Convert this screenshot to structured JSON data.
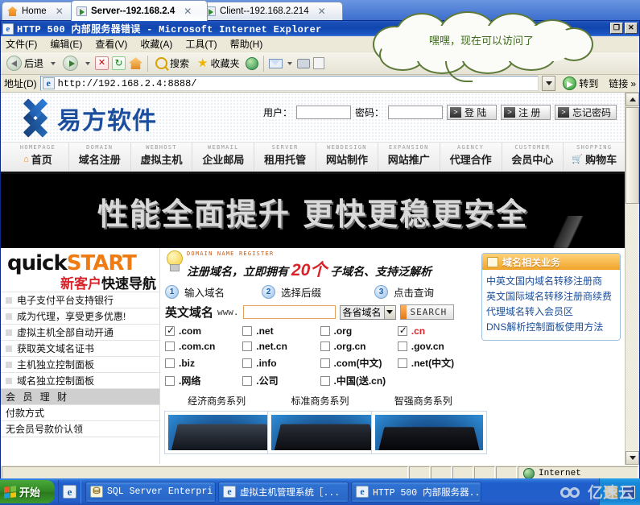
{
  "tabs": [
    {
      "label": "Home",
      "icon": "home-icon",
      "active": false
    },
    {
      "label": "Server--192.168.2.4",
      "icon": "remote-desktop-icon",
      "active": true
    },
    {
      "label": "Client--192.168.2.214",
      "icon": "remote-desktop-icon",
      "active": false
    }
  ],
  "window": {
    "title": "HTTP 500 内部服务器错误 - Microsoft Internet Explorer",
    "restore_label": "❐",
    "close_label": "✕"
  },
  "menubar": [
    "文件(F)",
    "编辑(E)",
    "查看(V)",
    "收藏(A)",
    "工具(T)",
    "帮助(H)"
  ],
  "toolbar": {
    "back": "后退",
    "forward": "",
    "stop": "",
    "refresh": "",
    "home": "",
    "search": "搜索",
    "favorites": "收藏夹",
    "history": "",
    "mail": "",
    "print": "",
    "edit": ""
  },
  "addressbar": {
    "label": "地址(D)",
    "url": "http://192.168.2.4:8888/",
    "go_label": "转到",
    "links_label": "链接"
  },
  "bubble": {
    "text": "嘿嘿，现在可以访问了"
  },
  "page": {
    "brand": "易方软件",
    "login": {
      "user_label": "用户：",
      "user_value": "",
      "pass_label": "密码：",
      "pass_value": "",
      "login_btn": "登 陆",
      "register_btn": "注 册",
      "forgot_btn": "忘记密码"
    },
    "nav": [
      {
        "en": "HOMEPAGE",
        "cn": "首页",
        "icon": "home-mini-icon"
      },
      {
        "en": "DOMAIN",
        "cn": "域名注册",
        "icon": ""
      },
      {
        "en": "WEBHOST",
        "cn": "虚拟主机",
        "icon": ""
      },
      {
        "en": "WEBMAIL",
        "cn": "企业邮局",
        "icon": ""
      },
      {
        "en": "SERVER",
        "cn": "租用托管",
        "icon": ""
      },
      {
        "en": "WEBDESIGN",
        "cn": "网站制作",
        "icon": ""
      },
      {
        "en": "EXPANSION",
        "cn": "网站推广",
        "icon": ""
      },
      {
        "en": "AGENCY",
        "cn": "代理合作",
        "icon": ""
      },
      {
        "en": "CUSTOMER",
        "cn": "会员中心",
        "icon": ""
      },
      {
        "en": "SHOPPING",
        "cn": "购物车",
        "icon": "cart-icon"
      }
    ],
    "banner": "性能全面提升 更快更稳更安全",
    "quickstart": {
      "logo_a": "quick",
      "logo_b": "START",
      "sub_red": "新客户",
      "sub_black": "快速导航",
      "items": [
        "电子支付平台支持银行",
        "成为代理，享受更多优惠!",
        "虚拟主机全部自动开通",
        "获取英文域名证书",
        "主机独立控制面板",
        "域名独立控制面板"
      ],
      "section_header": "会 员 理 财",
      "section_items": [
        "付款方式",
        "无会员号款价认领"
      ]
    },
    "domain": {
      "promo_en": "DOMAIN NAME REGISTER",
      "promo_cn_a": "注册域名，立即拥有",
      "promo_big": "20个",
      "promo_cn_b": "子域名、支持泛解析",
      "steps": [
        {
          "n": "1",
          "label": "输入域名"
        },
        {
          "n": "2",
          "label": "选择后缀"
        },
        {
          "n": "3",
          "label": "点击查询"
        }
      ],
      "field_label": "英文域名",
      "www_prefix": "www.",
      "input_value": "",
      "select_value": "各省域名",
      "search_btn": "SEARCH",
      "tlds": [
        [
          {
            "name": ".com",
            "checked": true,
            "red": false
          },
          {
            "name": ".net",
            "checked": false,
            "red": false
          },
          {
            "name": ".org",
            "checked": false,
            "red": false
          },
          {
            "name": ".cn",
            "checked": true,
            "red": true
          }
        ],
        [
          {
            "name": ".com.cn",
            "checked": false,
            "red": false
          },
          {
            "name": ".net.cn",
            "checked": false,
            "red": false
          },
          {
            "name": ".org.cn",
            "checked": false,
            "red": false
          },
          {
            "name": ".gov.cn",
            "checked": false,
            "red": false
          }
        ],
        [
          {
            "name": ".biz",
            "checked": false,
            "red": false
          },
          {
            "name": ".info",
            "checked": false,
            "red": false
          },
          {
            "name": ".com(中文)",
            "checked": false,
            "red": false
          },
          {
            "name": ".net(中文)",
            "checked": false,
            "red": false
          }
        ],
        [
          {
            "name": ".网络",
            "checked": false,
            "red": false
          },
          {
            "name": ".公司",
            "checked": false,
            "red": false
          },
          {
            "name": ".中国(送.cn)",
            "checked": false,
            "red": false
          },
          {
            "name": "",
            "checked": false,
            "red": false
          }
        ]
      ]
    },
    "products": [
      {
        "title": "经济商务系列"
      },
      {
        "title": "标准商务系列"
      },
      {
        "title": "智强商务系列"
      }
    ],
    "sidepanel": {
      "header": "域名相关业务",
      "items": [
        "中英文国内域名转移注册商",
        "英文国际域名转移注册商续费",
        "代理域名转入会员区",
        "DNS解析控制面板使用方法"
      ]
    }
  },
  "statusbar": {
    "zone": "Internet"
  },
  "taskbar": {
    "start": "开始",
    "tasks": [
      {
        "label": "SQL Server Enterpri...",
        "icon": "sql-server-icon"
      },
      {
        "label": "虚拟主机管理系统［...",
        "icon": "ie-icon"
      },
      {
        "label": "HTTP 500 内部服务器...",
        "icon": "ie-icon"
      }
    ]
  },
  "watermark": {
    "text": "亿速云"
  }
}
